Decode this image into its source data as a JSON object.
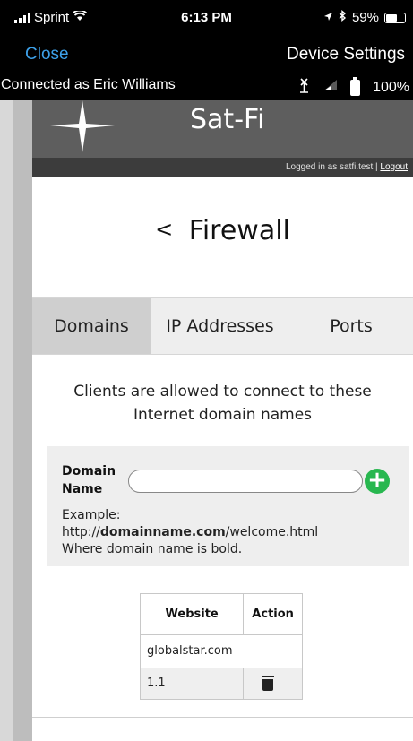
{
  "status_bar": {
    "carrier": "Sprint",
    "time": "6:13 PM",
    "battery": "59%"
  },
  "nav": {
    "close_label": "Close",
    "title": "Device Settings"
  },
  "connection": {
    "text": "Connected as Eric Williams",
    "battery": "100%"
  },
  "banner": {
    "brand": "Sat-Fi",
    "logged_in_text": "Logged in as satfi.test |",
    "logout_label": "Logout"
  },
  "page": {
    "back_glyph": "<",
    "title": "Firewall"
  },
  "tabs": [
    {
      "label": "Domains",
      "active": true
    },
    {
      "label": "IP Addresses",
      "active": false
    },
    {
      "label": "Ports",
      "active": false
    }
  ],
  "description": "Clients are allowed to connect to these Internet domain names",
  "form": {
    "label_line1": "Domain",
    "label_line2": "Name",
    "input_value": "",
    "add_glyph": "+",
    "example_label": "Example:",
    "example_prefix": "http://",
    "example_bold": "domainname.com",
    "example_suffix": "/welcome.html",
    "example_note": "Where domain name is bold."
  },
  "table": {
    "headers": [
      "Website",
      "Action"
    ],
    "rows": [
      [
        "globalstar.com",
        ""
      ],
      [
        "1.1",
        "trash-icon"
      ]
    ]
  },
  "colors": {
    "link": "#3da0e8",
    "add_button": "#28b74f",
    "banner": "#5e5e5e"
  }
}
